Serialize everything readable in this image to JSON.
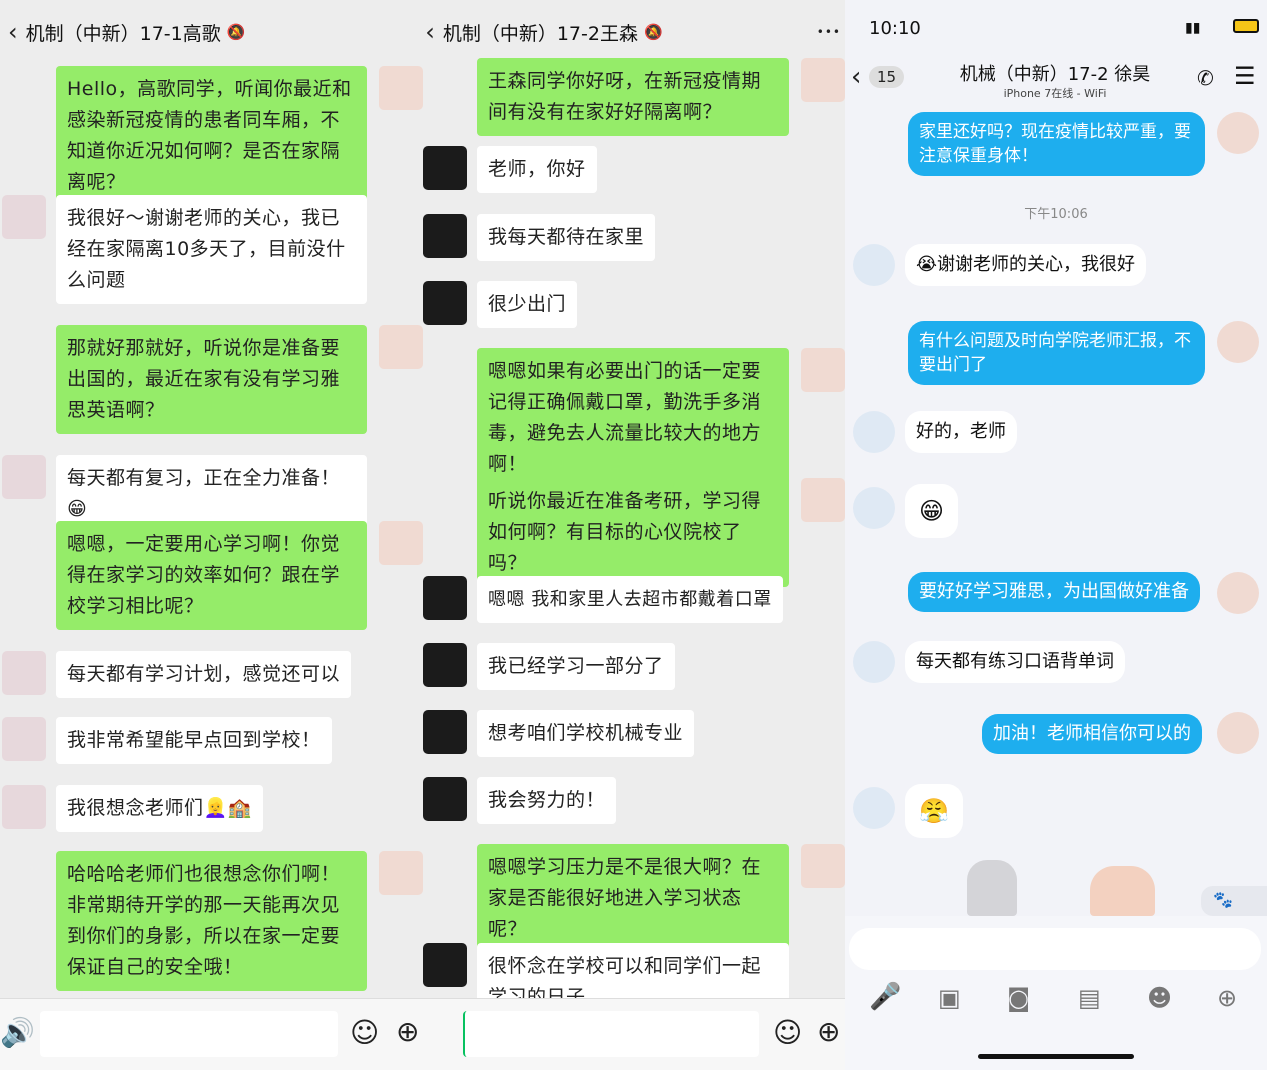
{
  "p1": {
    "title": "机制（中新）17-1高歌",
    "msgs": [
      "Hello，高歌同学，听闻你最近和感染新冠疫情的患者同车厢，不知道你近况如何啊？是否在家隔离呢？",
      "我很好～谢谢老师的关心，我已经在家隔离10多天了，目前没什么问题",
      "那就好那就好，听说你是准备要出国的，最近在家有没有学习雅思英语啊？",
      "每天都有复习，正在全力准备！😁",
      "嗯嗯，一定要用心学习啊！你觉得在家学习的效率如何？跟在学校学习相比呢？",
      "每天都有学习计划，感觉还可以",
      "我非常希望能早点回到学校！",
      "我很想念老师们👱‍♀️🏫",
      "哈哈哈老师们也很想念你们啊！非常期待开学的那一天能再次见到你们的身影，所以在家一定要保证自己的安全哦！"
    ]
  },
  "p2": {
    "title": "机制（中新）17-2王森",
    "dots": "•••",
    "msgs": [
      "王森同学你好呀，在新冠疫情期间有没有在家好好隔离啊？",
      "老师，你好",
      "我每天都待在家里",
      "很少出门",
      "嗯嗯如果有必要出门的话一定要记得正确佩戴口罩，勤洗手多消毒，避免去人流量比较大的地方啊！",
      "听说你最近在准备考研，学习得如何啊？有目标的心仪院校了吗？",
      "嗯嗯 我和家里人去超市都戴着口罩",
      "我已经学习一部分了",
      "想考咱们学校机械专业",
      "我会努力的！",
      "嗯嗯学习压力是不是很大啊？在家是否能很好地进入学习状态呢？",
      "很怀念在学校可以和同学们一起学习的日子"
    ]
  },
  "p3": {
    "time": "10:10",
    "back_count": "15",
    "title": "机械（中新）17-2 徐昊",
    "subtitle": "iPhone 7在线 - WiFi",
    "timestamp": "下午10:06",
    "msgs": [
      "家里还好吗？现在疫情比较严重，要注意保重身体！",
      "😭谢谢老师的关心，我很好",
      "有什么问题及时向学院老师汇报，不要出门了",
      "好的，老师",
      "😁",
      "要好好学习雅思，为出国做好准备",
      "每天都有练习口语背单词",
      "加油！老师相信你可以的",
      "😤"
    ]
  },
  "colors": {
    "wechat_green": "#95ec69",
    "qq_blue": "#1eaeee"
  },
  "icons": [
    "back-icon",
    "more-icon",
    "voice-icon",
    "emoji-icon",
    "plus-icon",
    "phone-icon",
    "menu-icon",
    "mic-icon",
    "image-icon",
    "camera-icon",
    "red-packet-icon",
    "smiley-icon",
    "add-icon",
    "paw-icon"
  ]
}
